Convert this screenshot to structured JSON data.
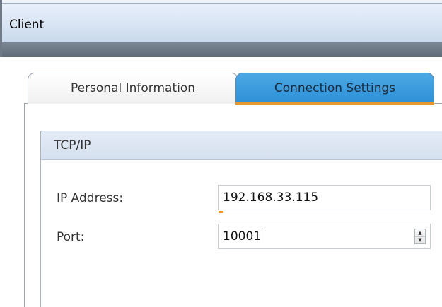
{
  "window": {
    "title": "Client"
  },
  "tabs": [
    {
      "label": "Personal Information",
      "selected": false
    },
    {
      "label": "Connection Settings",
      "selected": true
    }
  ],
  "group": {
    "title": "TCP/IP",
    "fields": {
      "ip_address": {
        "label": "IP Address:",
        "value": "192.168.33.115"
      },
      "port": {
        "label": "Port:",
        "value": "10001"
      }
    }
  },
  "icons": {
    "spin_up": "spinner-up-icon",
    "spin_down": "spinner-down-icon"
  },
  "colors": {
    "selected_tab": "#2d8fd6",
    "tab_underline": "#e8972e",
    "title_bar": "#d7e3f3",
    "dark_strip": "#6b7682"
  }
}
